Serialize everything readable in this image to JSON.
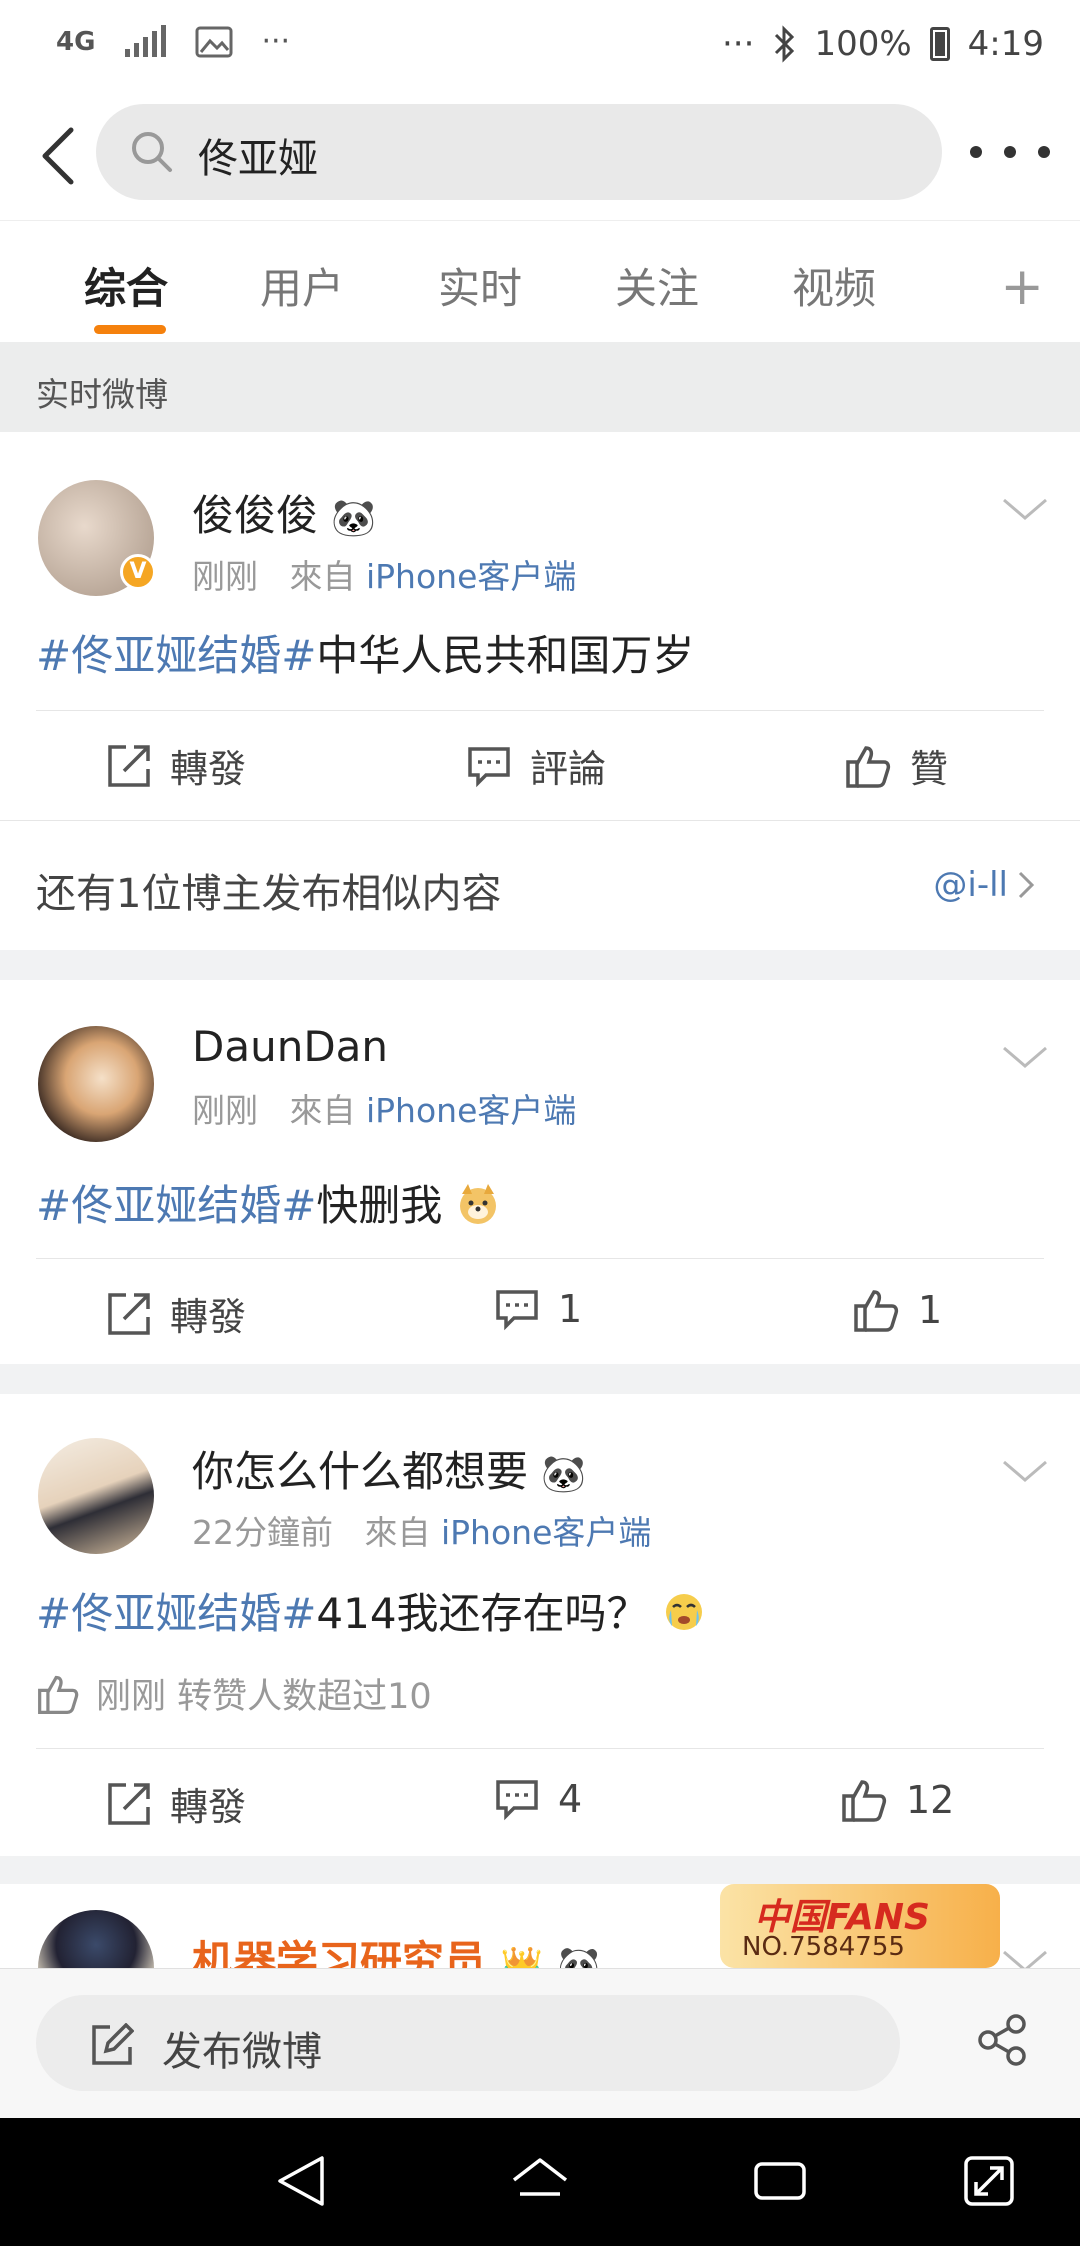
{
  "status_bar": {
    "network": "4G",
    "dots_left": "···",
    "dots_right": "···",
    "battery": "100%",
    "time": "4:19"
  },
  "search": {
    "query": "佟亚娅"
  },
  "tabs": [
    {
      "label": "综合",
      "active": true
    },
    {
      "label": "用户",
      "active": false
    },
    {
      "label": "实时",
      "active": false
    },
    {
      "label": "关注",
      "active": false
    },
    {
      "label": "视频",
      "active": false
    }
  ],
  "tab_plus": "+",
  "section_label": "实时微博",
  "posts": [
    {
      "username": "俊俊俊",
      "time": "刚刚",
      "from_label": "來自",
      "source": "iPhone客户端",
      "hashtag": "#佟亚娅结婚#",
      "text": "中华人民共和国万岁",
      "repost_label": "轉發",
      "comment_label": "評論",
      "like_label": "贊"
    },
    {
      "username": "DaunDan",
      "time": "刚刚",
      "from_label": "來自",
      "source": "iPhone客户端",
      "hashtag": "#佟亚娅结婚#",
      "text": "快删我",
      "repost_label": "轉發",
      "comment_count": "1",
      "like_count": "1"
    },
    {
      "username": "你怎么什么都想要",
      "time": "22分鐘前",
      "from_label": "來自",
      "source": "iPhone客户端",
      "hashtag": "#佟亚娅结婚#",
      "text": "414我还存在吗？",
      "like_info": "刚刚 转赞人数超过10",
      "repost_label": "轉發",
      "comment_count": "4",
      "like_count": "12"
    },
    {
      "username": "机器学习研究员",
      "fans_badge_title": "中国FANS",
      "fans_badge_no": "NO.7584755"
    }
  ],
  "similar": {
    "text": "还有1位博主发布相似内容",
    "link": "@i-ll"
  },
  "composer": {
    "label": "发布微博"
  },
  "colors": {
    "accent": "#f5810d",
    "link": "#4d79b2"
  }
}
